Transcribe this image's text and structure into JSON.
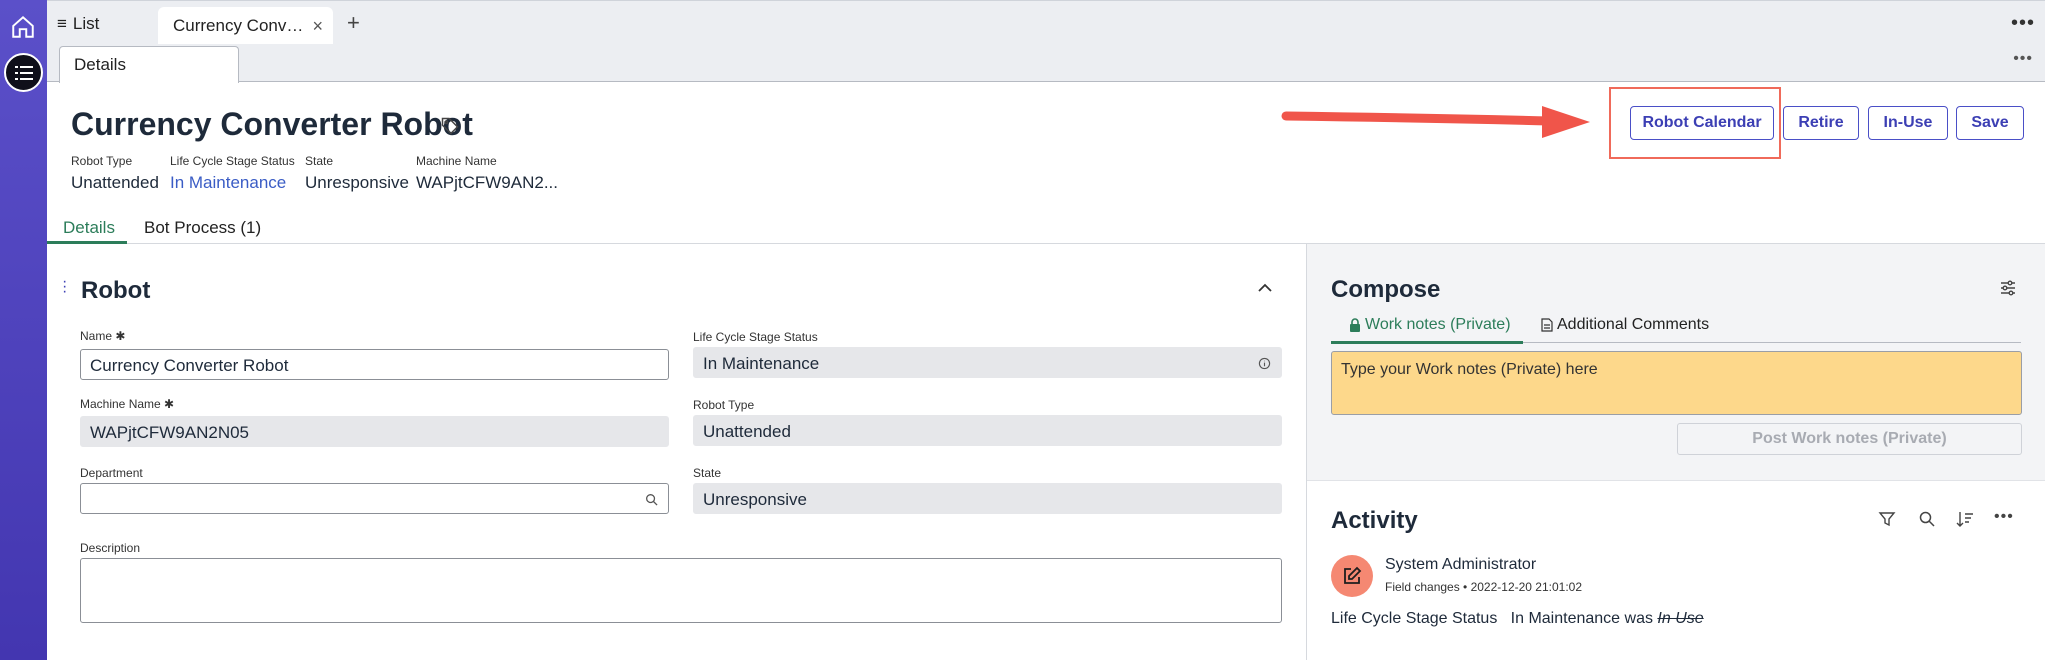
{
  "tabs": {
    "list_label": "List",
    "active_tab_label": "Currency Converter Robot",
    "sub_tab_label": "Details"
  },
  "header": {
    "title": "Currency Converter Robot",
    "meta": [
      {
        "label": "Robot Type",
        "value": "Unattended"
      },
      {
        "label": "Life Cycle Stage Status",
        "value": "In Maintenance"
      },
      {
        "label": "State",
        "value": "Unresponsive"
      },
      {
        "label": "Machine Name",
        "value": "WAPjtCFW9AN2..."
      }
    ],
    "buttons": {
      "robot_calendar": "Robot Calendar",
      "retire": "Retire",
      "in_use": "In-Use",
      "save": "Save"
    }
  },
  "form_tabs": [
    {
      "label": "Details"
    },
    {
      "label": "Bot Process (1)"
    }
  ],
  "robot_section": {
    "title": "Robot",
    "fields": {
      "name": {
        "label": "Name",
        "value": "Currency Converter Robot"
      },
      "machine_name": {
        "label": "Machine Name",
        "value": "WAPjtCFW9AN2N05"
      },
      "department": {
        "label": "Department",
        "value": ""
      },
      "description": {
        "label": "Description",
        "value": ""
      },
      "life_cycle": {
        "label": "Life Cycle Stage Status",
        "value": "In Maintenance"
      },
      "robot_type": {
        "label": "Robot Type",
        "value": "Unattended"
      },
      "state": {
        "label": "State",
        "value": "Unresponsive"
      }
    }
  },
  "compose": {
    "title": "Compose",
    "tab_work_notes": "Work notes (Private)",
    "tab_additional": "Additional Comments",
    "placeholder": "Type your Work notes (Private) here",
    "post_button": "Post Work notes (Private)"
  },
  "activity": {
    "title": "Activity",
    "user": "System Administrator",
    "subtitle": "Field changes • 2022-12-20 21:01:02",
    "change_field": "Life Cycle Stage Status",
    "change_new": "In Maintenance",
    "change_was_word": "was",
    "change_old": "In Use"
  },
  "colors": {
    "rail": "#4b3fbd",
    "accent_green": "#2c7d5a",
    "button_blue": "#3c3fb4",
    "link_blue": "#3a5cc5",
    "highlight_red": "#f06a5a",
    "work_notes_bg": "#fdd88b",
    "avatar_bg": "#f58872"
  }
}
